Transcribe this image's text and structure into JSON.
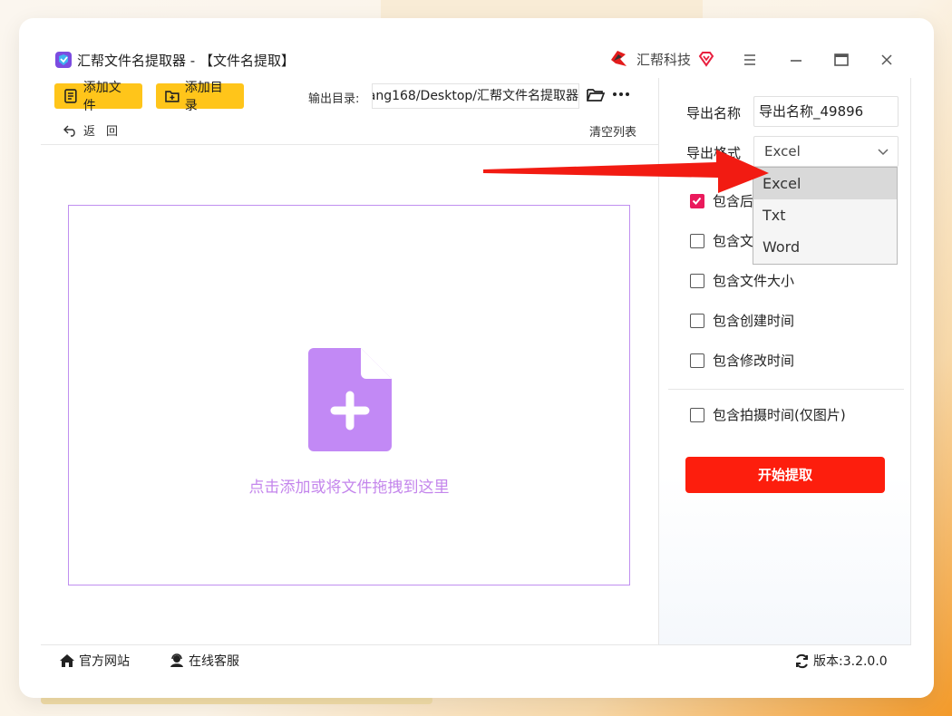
{
  "app": {
    "title": "汇帮文件名提取器 - 【文件名提取】",
    "brand": "汇帮科技"
  },
  "toolbar": {
    "add_file": "添加文件",
    "add_dir": "添加目录",
    "output_label": "输出目录:",
    "output_path": "ang168/Desktop/汇帮文件名提取器",
    "back": "返回",
    "clear_list": "清空列表"
  },
  "dropzone": {
    "hint": "点击添加或将文件拖拽到这里"
  },
  "settings": {
    "export_name_label": "导出名称",
    "export_name_value": "导出名称_49896",
    "export_format_label": "导出格式",
    "export_format_value": "Excel",
    "format_options": [
      "Excel",
      "Txt",
      "Word"
    ],
    "options": [
      {
        "label": "包含后",
        "checked": true
      },
      {
        "label": "包含文",
        "checked": false
      },
      {
        "label": "包含文件大小",
        "checked": false
      },
      {
        "label": "包含创建时间",
        "checked": false
      },
      {
        "label": "包含修改时间",
        "checked": false
      },
      {
        "label": "包含拍摄时间(仅图片)",
        "checked": false
      }
    ],
    "start_button": "开始提取"
  },
  "footer": {
    "website": "官方网站",
    "service": "在线客服",
    "version": "版本:3.2.0.0"
  },
  "colors": {
    "accent_yellow": "#ffc51a",
    "start_red": "#fd1e0d",
    "check_pink": "#ea1a5c",
    "dropzone_purple": "#c486ec"
  }
}
